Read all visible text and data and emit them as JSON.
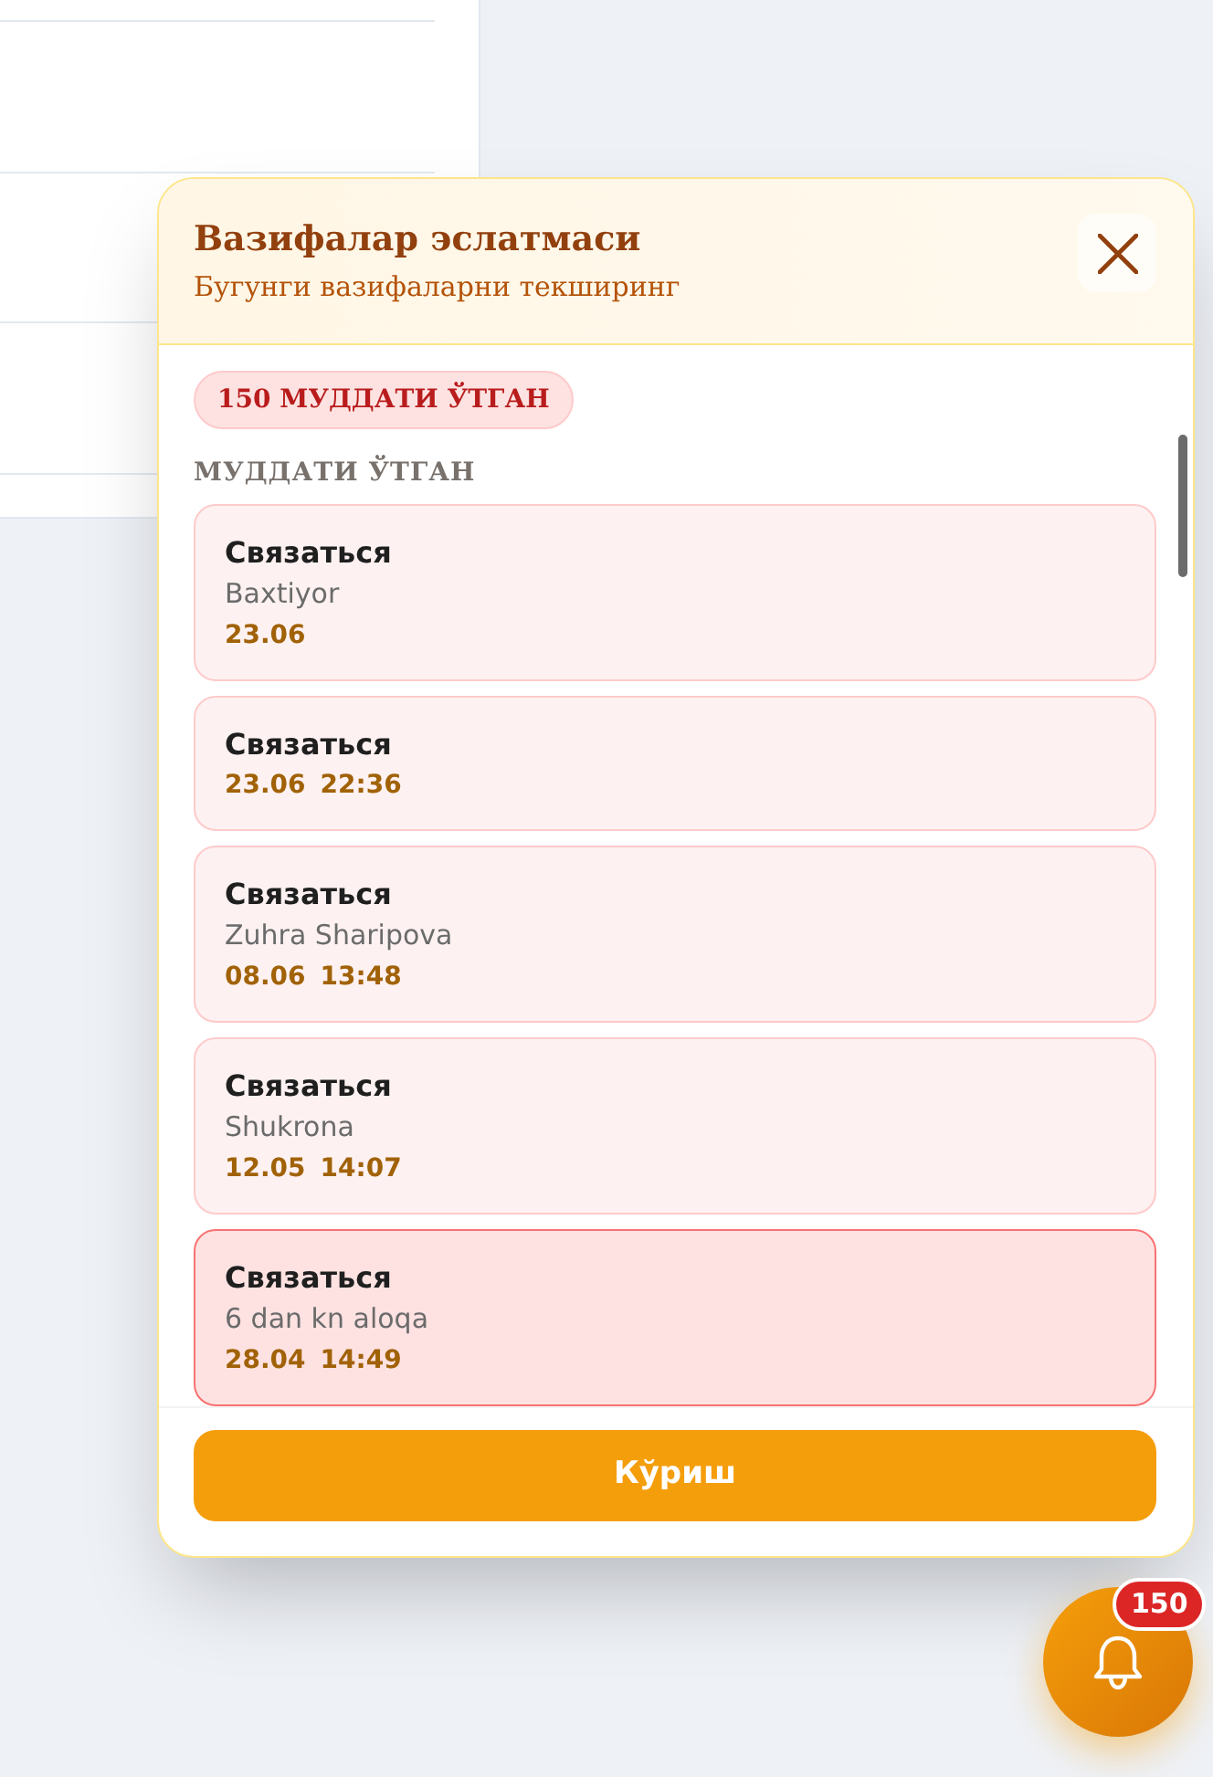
{
  "reminder": {
    "title": "Вазифалар эслатмаси",
    "subtitle": "Бугунги вазифаларни текширинг"
  },
  "overdue_badge": "150 МУДДАТИ ЎТГАН",
  "section_label": "МУДДАТИ ЎТГАН",
  "tasks": [
    {
      "title": "Связаться",
      "name": "Baxtiyor",
      "date": "23.06",
      "selected": false
    },
    {
      "title": "Связаться",
      "date": "23.06",
      "time": "22:36",
      "selected": false
    },
    {
      "title": "Связаться",
      "name": "Zuhra Sharipova",
      "date": "08.06",
      "time": "13:48",
      "selected": false
    },
    {
      "title": "Связаться",
      "name": "Shukrona",
      "date": "12.05",
      "time": "14:07",
      "selected": false
    },
    {
      "title": "Связаться",
      "name": "6 dan kn aloqa",
      "date": "28.04",
      "time": "14:49",
      "selected": true
    }
  ],
  "view_button": "Кўриш",
  "bell": {
    "count": "150"
  }
}
